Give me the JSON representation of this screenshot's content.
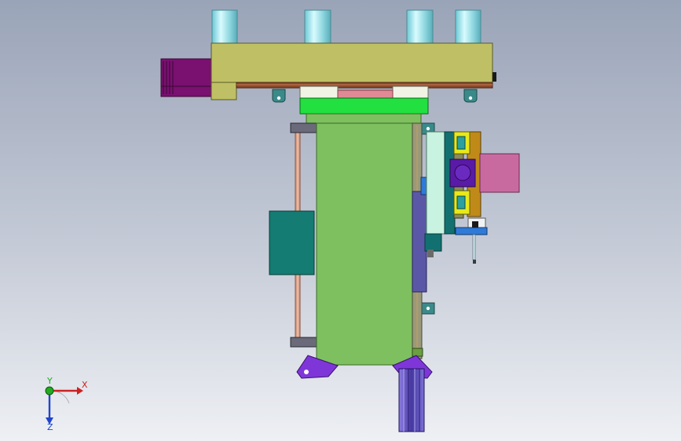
{
  "viewport": {
    "background_top": "#9aa4b8",
    "background_bottom": "#eef0f4"
  },
  "model": {
    "parts": [
      {
        "name": "cylinder-tube",
        "count": 4,
        "color": "#9fdfe6"
      },
      {
        "name": "top-beam",
        "color": "#bfc066"
      },
      {
        "name": "servo-motor",
        "color": "#7a1070"
      },
      {
        "name": "mounting-bracket",
        "color": "#3a8a8a"
      },
      {
        "name": "slide-plate",
        "color": "#22e040"
      },
      {
        "name": "pad-pink",
        "color": "#e08a96"
      },
      {
        "name": "main-body",
        "color": "#7ec060"
      },
      {
        "name": "control-box",
        "color": "#147c72"
      },
      {
        "name": "guide-rod",
        "color": "#d8a088"
      },
      {
        "name": "gripper-assembly",
        "color": "#c08a18"
      },
      {
        "name": "gripper-jaw",
        "color": "#e8e81a"
      },
      {
        "name": "side-motor",
        "color": "#c86aa0"
      },
      {
        "name": "base-foot",
        "color": "#7f36d8"
      },
      {
        "name": "lower-column",
        "color": "#6a5aa8"
      }
    ]
  },
  "triad": {
    "x_label": "X",
    "y_label": "Y",
    "z_label": "Z",
    "x_color": "#cc2222",
    "y_color": "#22aa22",
    "z_color": "#2244cc"
  }
}
